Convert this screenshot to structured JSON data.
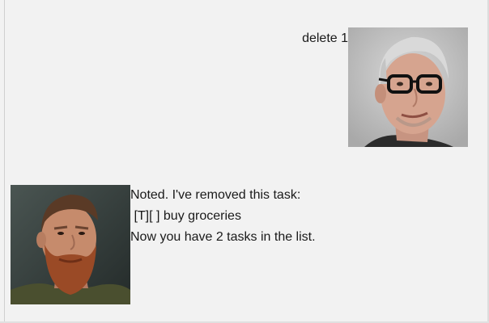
{
  "conversation": {
    "user_message": {
      "text": "delete 1",
      "avatar": "user-avatar-photo"
    },
    "bot_message": {
      "lines": [
        "Noted. I've removed this task:",
        " [T][ ] buy groceries",
        "Now you have 2 tasks in the list."
      ],
      "avatar": "bot-avatar-photo"
    }
  },
  "colors": {
    "background": "#f2f2f2",
    "text": "#1a1a1a"
  }
}
